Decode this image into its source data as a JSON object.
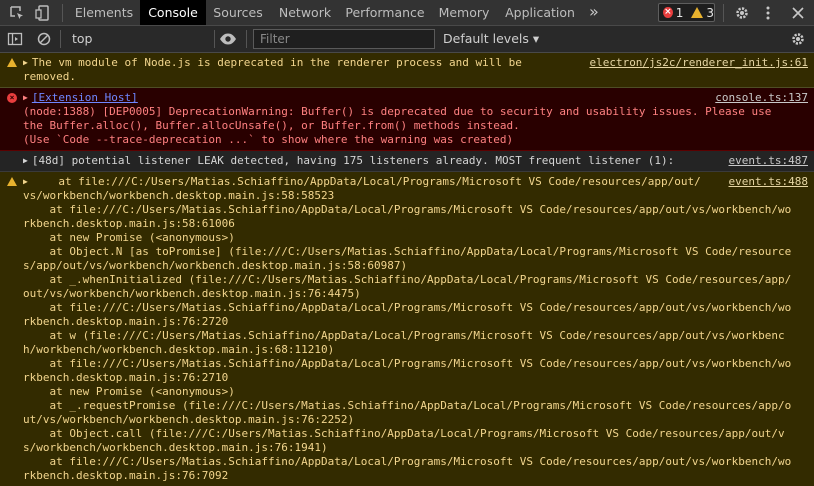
{
  "tabs": {
    "elements": "Elements",
    "console": "Console",
    "sources": "Sources",
    "network": "Network",
    "performance": "Performance",
    "memory": "Memory",
    "application": "Application",
    "more": "»"
  },
  "counts": {
    "errors": "1",
    "warnings": "3"
  },
  "toolbar": {
    "context": "top",
    "filter_placeholder": "Filter",
    "levels": "Default levels ▾"
  },
  "messages": {
    "m1": {
      "line1": "The vm module of Node.js is deprecated in the renderer process and will be",
      "line2": "removed.",
      "source": "electron/js2c/renderer_init.js:61"
    },
    "m2": {
      "tag": "[Extension Host]",
      "line1": "(node:1388) [DEP0005] DeprecationWarning: Buffer() is deprecated due to security and usability issues. Please use",
      "line2": "the Buffer.alloc(), Buffer.allocUnsafe(), or Buffer.from() methods instead.",
      "line3": "(Use `Code --trace-deprecation ...` to show where the warning was created)",
      "source": "console.ts:137"
    },
    "m3": {
      "text": "[48d] potential listener LEAK detected, having 175 listeners already. MOST frequent listener (1):",
      "source": "event.ts:487"
    },
    "m4": {
      "source": "event.ts:488",
      "l1": "    at file:///C:/Users/Matias.Schiaffino/AppData/Local/Programs/Microsoft VS Code/resources/app/out/",
      "l2": "vs/workbench/workbench.desktop.main.js:58:58523",
      "l3": "    at file:///C:/Users/Matias.Schiaffino/AppData/Local/Programs/Microsoft VS Code/resources/app/out/vs/workbench/wo",
      "l4": "rkbench.desktop.main.js:58:61006",
      "l5": "    at new Promise (<anonymous>)",
      "l6": "    at Object.N [as toPromise] (file:///C:/Users/Matias.Schiaffino/AppData/Local/Programs/Microsoft VS Code/resource",
      "l7": "s/app/out/vs/workbench/workbench.desktop.main.js:58:60987)",
      "l8": "    at _.whenInitialized (file:///C:/Users/Matias.Schiaffino/AppData/Local/Programs/Microsoft VS Code/resources/app/",
      "l9": "out/vs/workbench/workbench.desktop.main.js:76:4475)",
      "l10": "    at file:///C:/Users/Matias.Schiaffino/AppData/Local/Programs/Microsoft VS Code/resources/app/out/vs/workbench/wo",
      "l11": "rkbench.desktop.main.js:76:2720",
      "l12": "    at w (file:///C:/Users/Matias.Schiaffino/AppData/Local/Programs/Microsoft VS Code/resources/app/out/vs/workbenc",
      "l13": "h/workbench/workbench.desktop.main.js:68:11210)",
      "l14": "    at file:///C:/Users/Matias.Schiaffino/AppData/Local/Programs/Microsoft VS Code/resources/app/out/vs/workbench/wo",
      "l15": "rkbench.desktop.main.js:76:2710",
      "l16": "    at new Promise (<anonymous>)",
      "l17": "    at _.requestPromise (file:///C:/Users/Matias.Schiaffino/AppData/Local/Programs/Microsoft VS Code/resources/app/o",
      "l18": "ut/vs/workbench/workbench.desktop.main.js:76:2252)",
      "l19": "    at Object.call (file:///C:/Users/Matias.Schiaffino/AppData/Local/Programs/Microsoft VS Code/resources/app/out/v",
      "l20": "s/workbench/workbench.desktop.main.js:76:1941)",
      "l21": "    at file:///C:/Users/Matias.Schiaffino/AppData/Local/Programs/Microsoft VS Code/resources/app/out/vs/workbench/wo",
      "l22": "rkbench.desktop.main.js:76:7092"
    }
  },
  "colors": {
    "warning_bg": "#332b00",
    "warning_text": "#f2d58d",
    "error_bg": "#290000",
    "error_text": "#ff8080",
    "active_tab_bg": "#000000"
  },
  "icons": [
    "inspect-icon",
    "device-toolbar-icon",
    "error-icon",
    "warning-icon",
    "settings-gear-icon",
    "more-vertical-icon",
    "close-icon",
    "sidebar-toggle-icon",
    "clear-console-icon",
    "eye-icon",
    "gear-icon"
  ]
}
